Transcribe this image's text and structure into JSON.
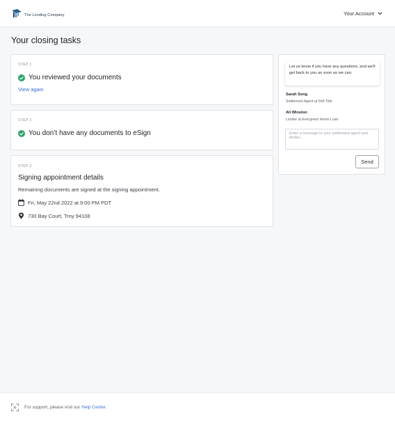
{
  "header": {
    "logo_text": "The Lending Company",
    "account_label": "Your Account"
  },
  "page": {
    "title": "Your closing tasks"
  },
  "steps": [
    {
      "label": "STEP 1",
      "heading": "You reviewed your documents",
      "link": "View again"
    },
    {
      "label": "STEP 2",
      "heading": "You don’t have any documents to eSign"
    },
    {
      "label": "STEP 3",
      "heading": "Signing appointment details",
      "description": "Remaining documents are signed at the signing appointment.",
      "datetime": "Fri, May 22nd 2022 at 9:00 PM PDT",
      "address": "730 Bay Court, Troy 94108"
    }
  ],
  "chat": {
    "bubble_text": "Let us know if you have any questions, and we'll get back to you as soon as we can.",
    "contacts": [
      {
        "name": "Sarah Song",
        "role": "Settlement Agent at DHI Title"
      },
      {
        "name": "Ali Winston",
        "role": "Lender at Evergreen Home Loan"
      }
    ],
    "input_placeholder": "Enter a message to your settlement agent and lender...",
    "send_label": "Send"
  },
  "footer": {
    "support_text": "For support, please visit our",
    "help_link": "Help Center",
    "period": "."
  },
  "colors": {
    "accent": "#3a6fd8",
    "success": "#2fa36b",
    "background": "#f6f7f9"
  },
  "icons": [
    "logo-icon",
    "chevron-down-icon",
    "check-circle-icon",
    "calendar-icon",
    "location-pin-icon",
    "support-icon"
  ]
}
